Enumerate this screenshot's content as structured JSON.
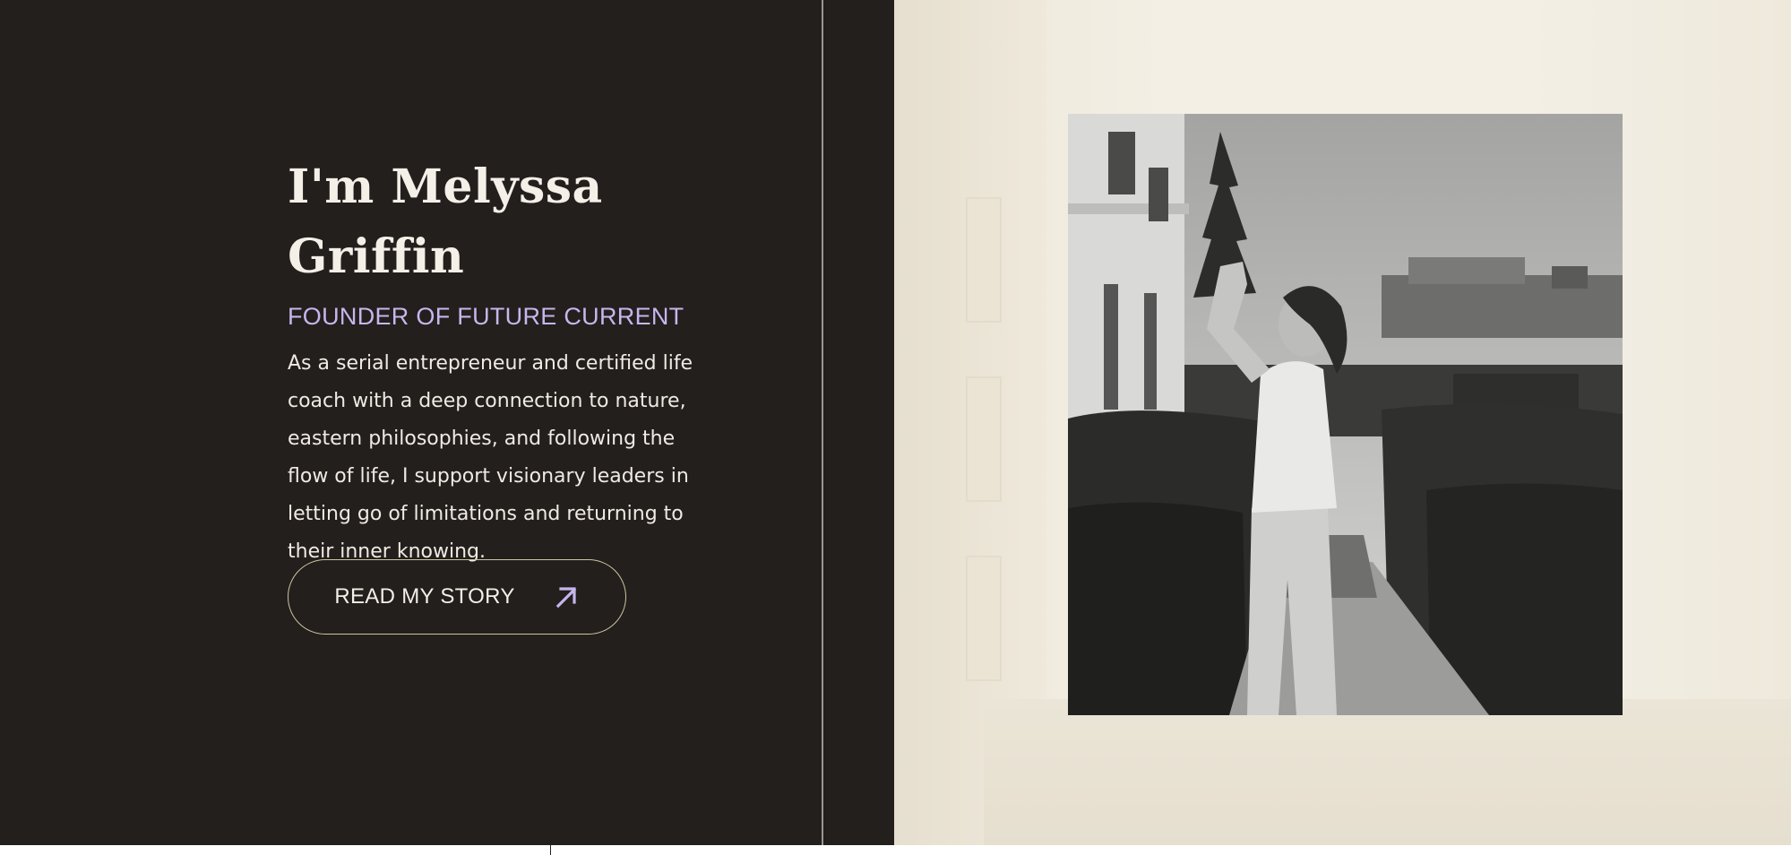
{
  "hero": {
    "title": "I'm Melyssa Griffin",
    "subtitle": "FOUNDER OF FUTURE CURRENT",
    "bio": "As a serial entrepreneur and certified life coach with a deep connection to nature, eastern philosophies, and following the flow of life, I support visionary leaders in letting go of limitations and returning to their inner knowing.",
    "cta": {
      "label": "READ MY STORY",
      "icon": "arrow-up-right-icon"
    }
  },
  "photo": {
    "icon": "portrait-photo",
    "style": "black-and-white"
  },
  "colors": {
    "dark_background": "#221f1d",
    "light_background": "#f3efe4",
    "heading": "#f4efe7",
    "accent": "#c7b6ec",
    "button_border": "#cfc4a2"
  }
}
